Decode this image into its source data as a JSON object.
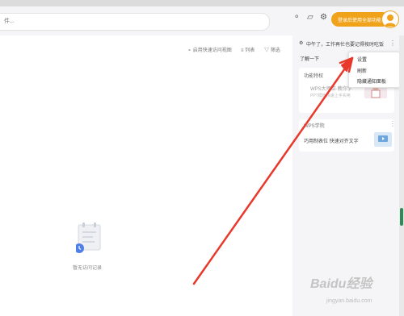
{
  "search": {
    "text": "件..."
  },
  "login": {
    "label": "登录后使用全部功能账号"
  },
  "toolbar": {
    "quick_view": "启用快速访问视图",
    "list": "列表",
    "filter": "筛选"
  },
  "empty_state": {
    "label": "暂无访问记录"
  },
  "right_panel": {
    "greeting": "中午了，工作再忙也要记得按时吃饭",
    "learn_more": "了解一下",
    "section_title": "功能特权",
    "card1_title": "WPS大师讲·教你学",
    "card1_sub": "PPT模板快速上手实用",
    "section2_title": "WPS学院",
    "card2_text": "巧用制表位 快速对齐文字"
  },
  "context_menu": {
    "items": [
      "设置",
      "刷新",
      "隐藏通知面板"
    ]
  },
  "watermark": {
    "main": "Baidu经验",
    "sub": "jingyan.baidu.com"
  }
}
